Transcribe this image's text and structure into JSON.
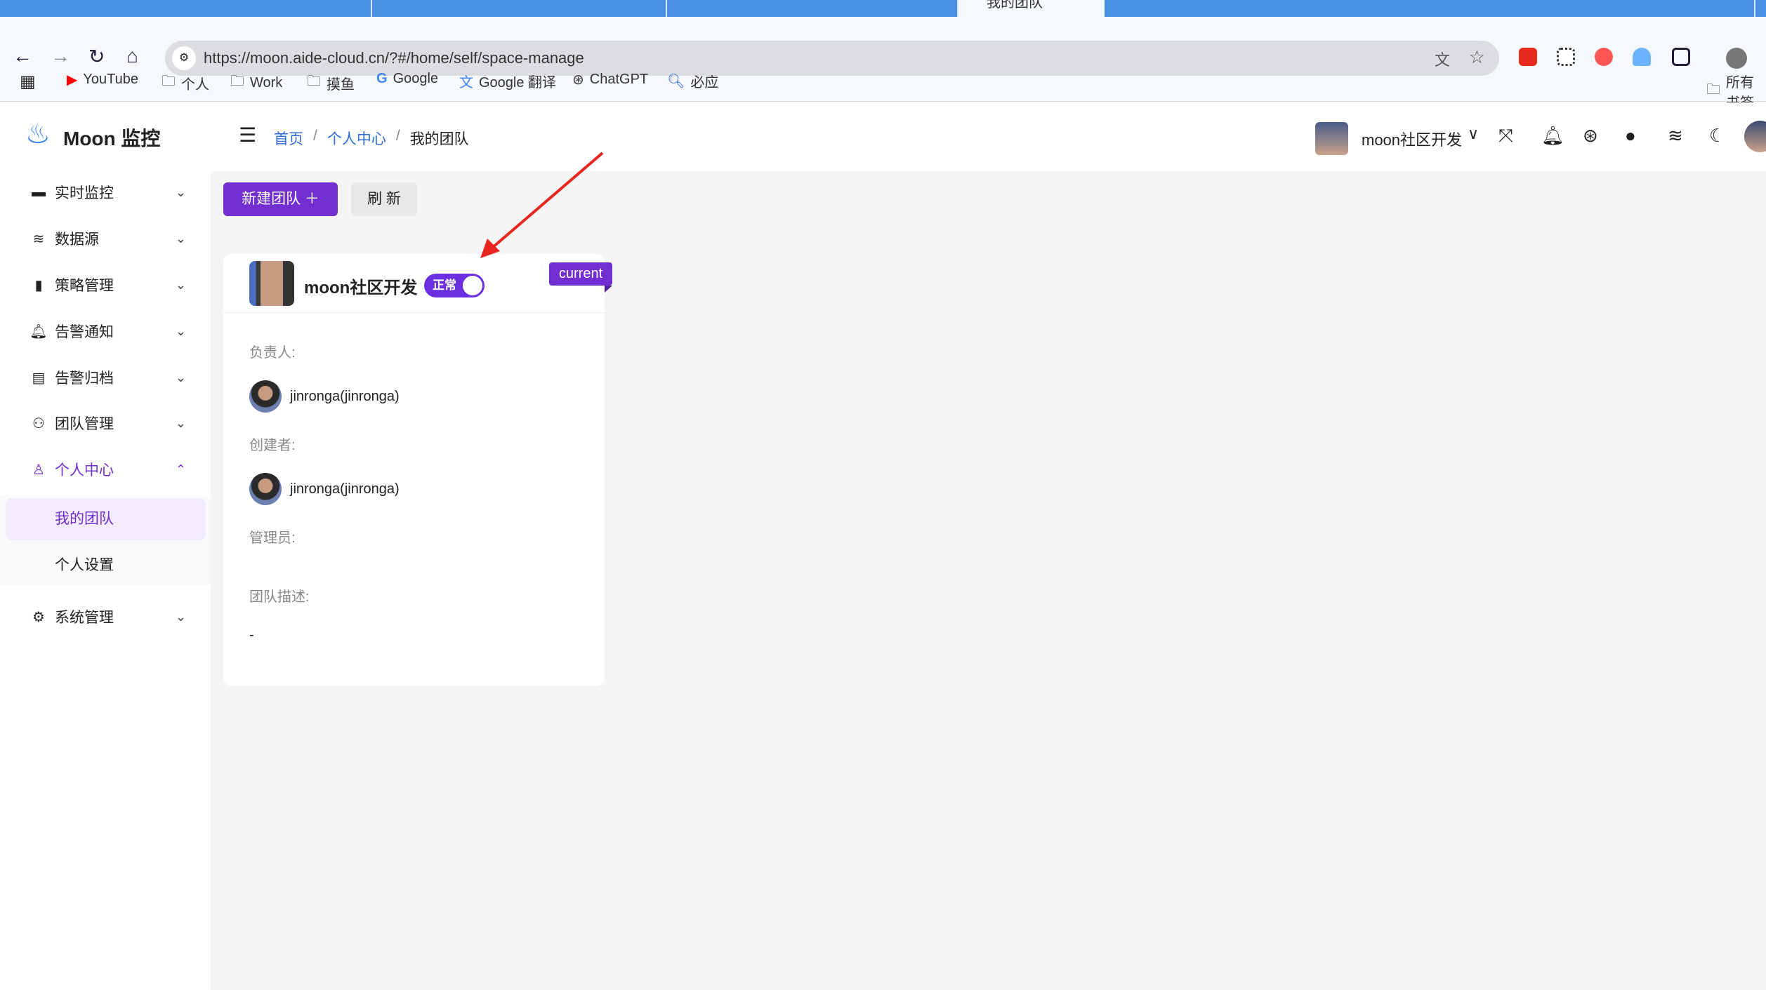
{
  "browser": {
    "active_tab": "我的团队",
    "url": "https://moon.aide-cloud.cn/?#/home/self/space-manage",
    "bookmarks": [
      "YouTube",
      "个人",
      "Work",
      "摸鱼",
      "Google",
      "Google 翻译",
      "ChatGPT",
      "必应"
    ],
    "all_bookmarks": "所有书签"
  },
  "app": {
    "logo_text": "Moon 监控"
  },
  "breadcrumb": [
    "首页",
    "个人中心",
    "我的团队"
  ],
  "header": {
    "team_name": "moon社区开发"
  },
  "sidebar": {
    "items": [
      {
        "label": "实时监控",
        "icon": "monitor-icon"
      },
      {
        "label": "数据源",
        "icon": "layers-icon"
      },
      {
        "label": "策略管理",
        "icon": "book-icon"
      },
      {
        "label": "告警通知",
        "icon": "bell-icon"
      },
      {
        "label": "告警归档",
        "icon": "archive-icon"
      },
      {
        "label": "团队管理",
        "icon": "team-icon"
      },
      {
        "label": "个人中心",
        "icon": "user-icon"
      }
    ],
    "sub_items": [
      {
        "label": "我的团队"
      },
      {
        "label": "个人设置"
      }
    ],
    "system": {
      "label": "系统管理",
      "icon": "gear-icon"
    }
  },
  "toolbar": {
    "new_team": "新建团队",
    "refresh": "刷 新"
  },
  "card": {
    "team_name": "moon社区开发",
    "status": "正常",
    "status_on": true,
    "current_badge": "current",
    "leader_label": "负责人:",
    "leader": "jinronga(jinronga)",
    "creator_label": "创建者:",
    "creator": "jinronga(jinronga)",
    "admin_label": "管理员:",
    "desc_label": "团队描述:",
    "desc": "-"
  },
  "colors": {
    "primary": "#722ed1",
    "accent": "#6b2fe0",
    "annotation_arrow": "#e8251e"
  }
}
